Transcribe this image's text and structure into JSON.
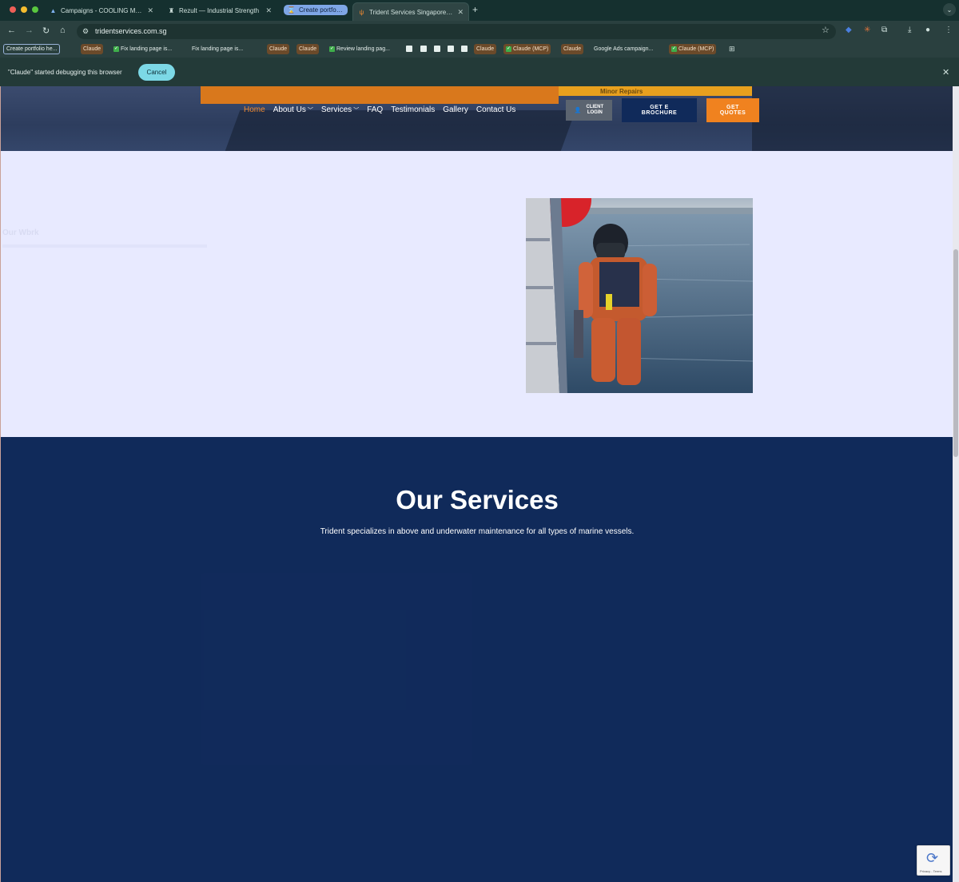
{
  "browser": {
    "tabs": [
      {
        "title": "Campaigns - COOLING MON",
        "icon": "google-ads-icon"
      },
      {
        "title": "Rezult — Industrial Strength",
        "icon": "rezult-icon"
      },
      {
        "title": "Create portfolio h",
        "icon": "hourglass-icon"
      },
      {
        "title": "Trident Services Singapore m",
        "icon": "trident-icon"
      }
    ],
    "url": "tridentservices.com.sg",
    "bookmarks": [
      "Create portfolio he...",
      "Claude",
      "Fix landing page is...",
      "Fix landing page is...",
      "Claude",
      "Claude",
      "Review landing pag...",
      "Claude",
      "Claude (MCP)",
      "Claude",
      "Google Ads campaign...",
      "Claude (MCP)"
    ],
    "debug_message": "\"Claude\" started debugging this browser",
    "cancel_label": "Cancel"
  },
  "site": {
    "banner_text": "Minor Repairs",
    "nav": {
      "home": "Home",
      "about": "About Us",
      "services": "Services",
      "faq": "FAQ",
      "testimonials": "Testimonials",
      "gallery": "Gallery",
      "contact": "Contact Us"
    },
    "buttons": {
      "client_login_1": "CLIENT",
      "client_login_2": "LOGIN",
      "brochure_1": "GET E",
      "brochure_2": "BROCHURE",
      "quotes_1": "GET",
      "quotes_2": "QUOTES"
    },
    "faded_heading": "Our Wbrk",
    "services_section": {
      "title": "Our Services",
      "subtitle": "Trident  specializes in above and underwater maintenance for all types of marine vessels."
    },
    "recaptcha_text": "Privacy - Terms"
  },
  "colors": {
    "navy": "#102a5a",
    "orange": "#f0821f",
    "lavender": "#e8eaff"
  }
}
